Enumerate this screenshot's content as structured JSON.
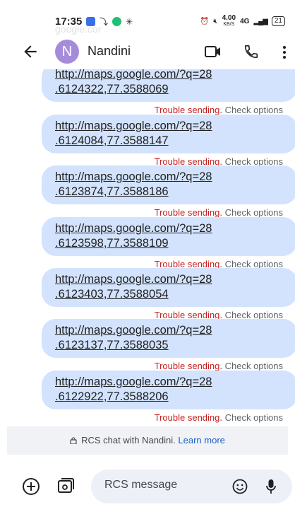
{
  "status_bar": {
    "time": "17:35",
    "speed_value": "4.00",
    "speed_unit": "KB/S",
    "network": "4G",
    "battery": "21",
    "ghost_overlay": "google.cor"
  },
  "header": {
    "avatar_letter": "N",
    "contact_name": "Nandini"
  },
  "messages": [
    {
      "line1": "http://maps.google.com/?q=28",
      "line2": ".6124322,77.3588069",
      "status": "Trouble sending.",
      "action": "Check options"
    },
    {
      "line1": "http://maps.google.com/?q=28",
      "line2": ".6124084,77.3588147",
      "status": "Trouble sending.",
      "action": "Check options"
    },
    {
      "line1": "http://maps.google.com/?q=28",
      "line2": ".6123874,77.3588186",
      "status": "Trouble sending.",
      "action": "Check options"
    },
    {
      "line1": "http://maps.google.com/?q=28",
      "line2": ".6123598,77.3588109",
      "status": "Trouble sending.",
      "action": "Check options"
    },
    {
      "line1": "http://maps.google.com/?q=28",
      "line2": ".6123403,77.3588054",
      "status": "Trouble sending.",
      "action": "Check options"
    },
    {
      "line1": "http://maps.google.com/?q=28",
      "line2": ".6123137,77.3588035",
      "status": "Trouble sending.",
      "action": "Check options"
    },
    {
      "line1": "http://maps.google.com/?q=28",
      "line2": ".6122922,77.3588206",
      "status": "Trouble sending.",
      "action": "Check options"
    }
  ],
  "rcs_banner": {
    "text": "RCS chat with Nandini.",
    "link": "Learn more"
  },
  "compose": {
    "placeholder": "RCS message"
  },
  "colors": {
    "bubble": "#d3e3fd",
    "error": "#c5221f",
    "accent": "#1a60c7",
    "avatar": "#a78bdb"
  }
}
